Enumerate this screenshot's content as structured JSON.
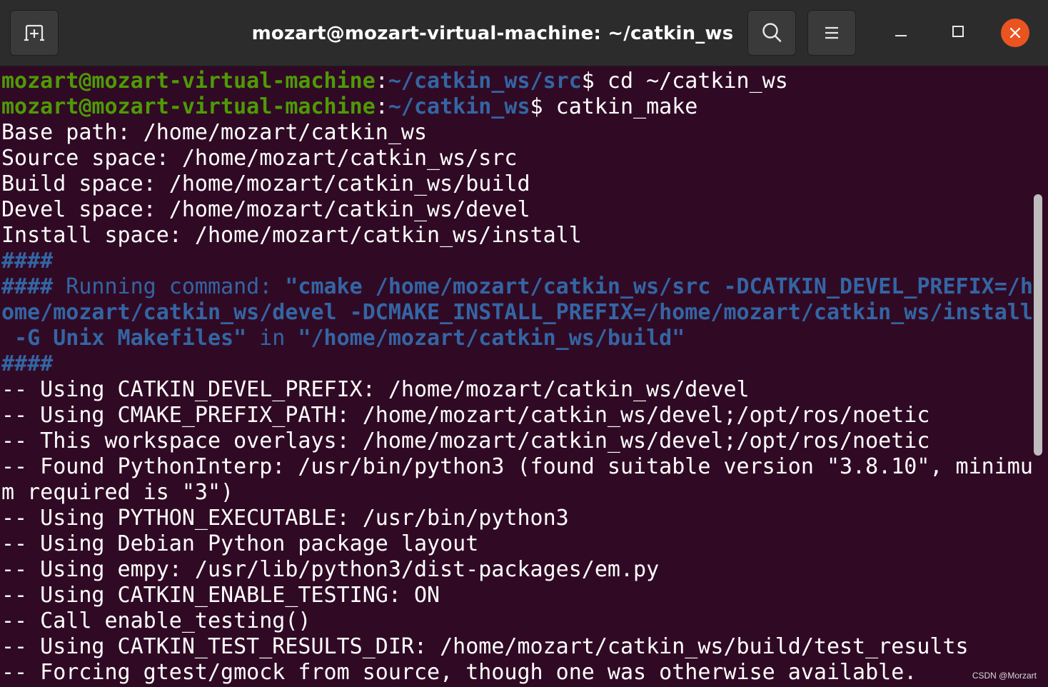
{
  "window": {
    "title": "mozart@mozart-virtual-machine: ~/catkin_ws",
    "icons": {
      "new_tab": "new-tab-icon",
      "search": "search-icon",
      "menu": "hamburger-menu-icon",
      "minimize": "minimize-icon",
      "maximize": "maximize-icon",
      "close": "close-icon"
    },
    "colors": {
      "terminal_bg": "#300a24",
      "prompt_user": "#4e9a06",
      "prompt_path": "#3465a4",
      "close_button": "#e95420",
      "text": "#ffffff"
    }
  },
  "prompts": [
    {
      "user_host": "mozart@mozart-virtual-machine",
      "sep": ":",
      "path": "~/catkin_ws/src",
      "symbol": "$",
      "command": " cd ~/catkin_ws"
    },
    {
      "user_host": "mozart@mozart-virtual-machine",
      "sep": ":",
      "path": "~/catkin_ws",
      "symbol": "$",
      "command": " catkin_make"
    }
  ],
  "output": {
    "paths": [
      "Base path: /home/mozart/catkin_ws",
      "Source space: /home/mozart/catkin_ws/src",
      "Build space: /home/mozart/catkin_ws/build",
      "Devel space: /home/mozart/catkin_ws/devel",
      "Install space: /home/mozart/catkin_ws/install"
    ],
    "running": {
      "hash_top": "####",
      "prefix_hash": "####",
      "label": " Running command: ",
      "cmd_line1": "\"cmake /home/mozart/catkin_ws/src -DCATKIN_DEVEL_PREFIX=/h",
      "cmd_line2": "ome/mozart/catkin_ws/devel -DCMAKE_INSTALL_PREFIX=/home/mozart/catkin_ws/install",
      "cmd_line3": " -G Unix Makefiles\"",
      "in_word": " in ",
      "dir": "\"/home/mozart/catkin_ws/build\"",
      "hash_bottom": "####"
    },
    "cmake": [
      "-- Using CATKIN_DEVEL_PREFIX: /home/mozart/catkin_ws/devel",
      "-- Using CMAKE_PREFIX_PATH: /home/mozart/catkin_ws/devel;/opt/ros/noetic",
      "-- This workspace overlays: /home/mozart/catkin_ws/devel;/opt/ros/noetic",
      "-- Found PythonInterp: /usr/bin/python3 (found suitable version \"3.8.10\", minimu",
      "m required is \"3\")",
      "-- Using PYTHON_EXECUTABLE: /usr/bin/python3",
      "-- Using Debian Python package layout",
      "-- Using empy: /usr/lib/python3/dist-packages/em.py",
      "-- Using CATKIN_ENABLE_TESTING: ON",
      "-- Call enable_testing()",
      "-- Using CATKIN_TEST_RESULTS_DIR: /home/mozart/catkin_ws/build/test_results",
      "-- Forcing gtest/gmock from source, though one was otherwise available."
    ]
  },
  "watermark": "CSDN @Morzart"
}
